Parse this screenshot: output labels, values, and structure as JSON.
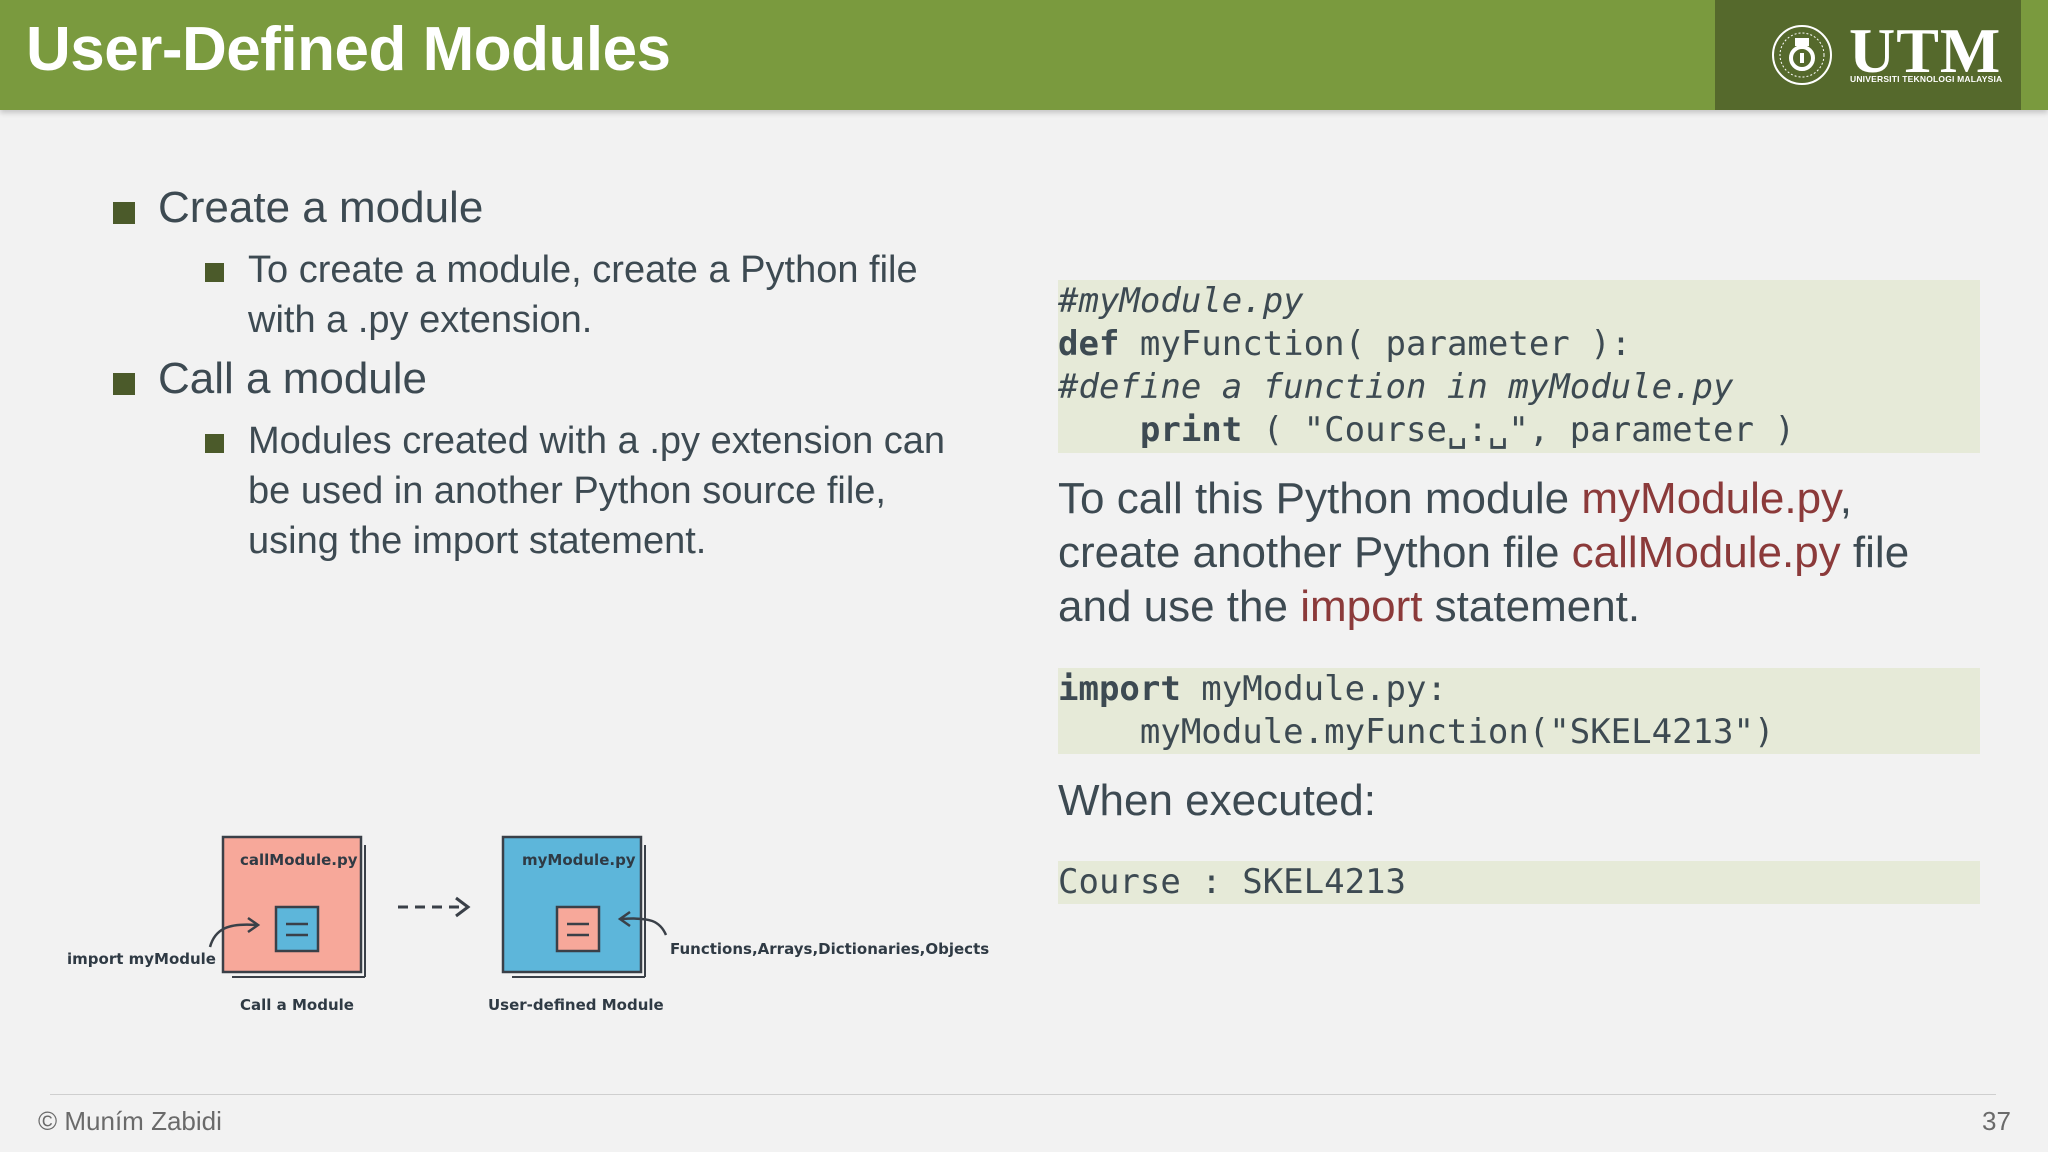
{
  "header": {
    "title": "User-Defined Modules",
    "logo_text": "UTM",
    "logo_subtext": "UNIVERSITI TEKNOLOGI MALAYSIA"
  },
  "bullets": {
    "create": {
      "label": "Create a module",
      "detail_lines": [
        "To create a module, create a Python file",
        "with a .py extension."
      ]
    },
    "call": {
      "label": "Call a module",
      "detail_lines": [
        "Modules created with a .py extension can",
        "be used in another Python source file,",
        "using the import statement."
      ]
    }
  },
  "code_module": {
    "line1": "#myModule.py",
    "line2_kw": "def",
    "line2_rest": " myFunction( parameter ):",
    "line3": "#define a function in myModule.py",
    "line4_indent": "    ",
    "line4_kw": "print",
    "line4_rest": " ( \"Course␣:␣\", parameter )"
  },
  "explanation": {
    "part1": "To call this Python module ",
    "hl1": "myModule.py",
    "part2": ",",
    "part3": "create another Python file ",
    "hl2": "callModule.py",
    "part4": " file",
    "part5": "and use the ",
    "hl3": "import",
    "part6": " statement."
  },
  "code_call": {
    "line1_kw": "import",
    "line1_rest": " myModule.py:",
    "line2": "    myModule.myFunction(\"SKEL4213\")"
  },
  "executed_label": "When executed:",
  "output": "Course : SKEL4213",
  "diagram": {
    "left_file": "callModule.py",
    "right_file": "myModule.py",
    "left_annotation": "import myModule",
    "right_annotation": "Functions,Arrays,Dictionaries,Objects",
    "left_caption": "Call a Module",
    "right_caption": "User-defined Module",
    "colors": {
      "left_box": "#f7a89a",
      "right_box": "#5db6da",
      "inner_left": "#5db6da",
      "inner_right": "#f7a89a"
    }
  },
  "footer": {
    "copyright": "© Muním Zabidi",
    "page_number": "37"
  }
}
